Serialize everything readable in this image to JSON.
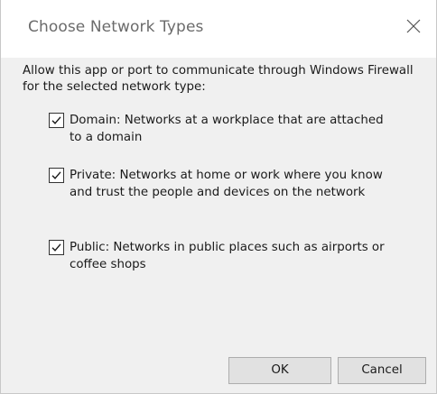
{
  "dialog": {
    "title": "Choose Network Types",
    "prompt": "Allow this app or port to communicate through Windows Firewall for the selected network type:",
    "options": [
      {
        "label": "Domain: Networks at a workplace that are attached to a domain",
        "checked": true
      },
      {
        "label": "Private:  Networks at home or work where you know and trust the people and devices on the network",
        "checked": true
      },
      {
        "label": "Public:  Networks in public places such as airports or coffee shops",
        "checked": true
      }
    ],
    "buttons": {
      "ok_label": "OK",
      "cancel_label": "Cancel"
    }
  },
  "icons": {
    "close": "close-icon",
    "check": "checkmark-icon"
  },
  "colors": {
    "title_text": "#6b6b6b",
    "dialog_bg": "#f0f0f0",
    "titlebar_bg": "#ffffff",
    "button_bg": "#e1e1e1",
    "button_border": "#adadad"
  }
}
